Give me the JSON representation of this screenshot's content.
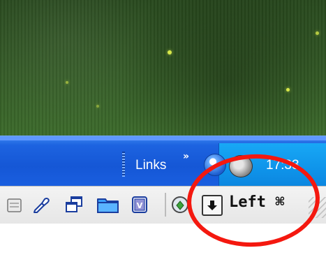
{
  "taskbar": {
    "links_label": "Links",
    "chevron_label": "»",
    "clock_time": "17:33"
  },
  "menubar": {
    "arrow_key_glyph": "🠗",
    "left_key_label": "Left ⌘"
  },
  "colors": {
    "taskbar_blue": "#1557d6",
    "tray_blue": "#0f94ea",
    "annotation_red": "#f4180f",
    "wallpaper_green": "#335a25"
  }
}
